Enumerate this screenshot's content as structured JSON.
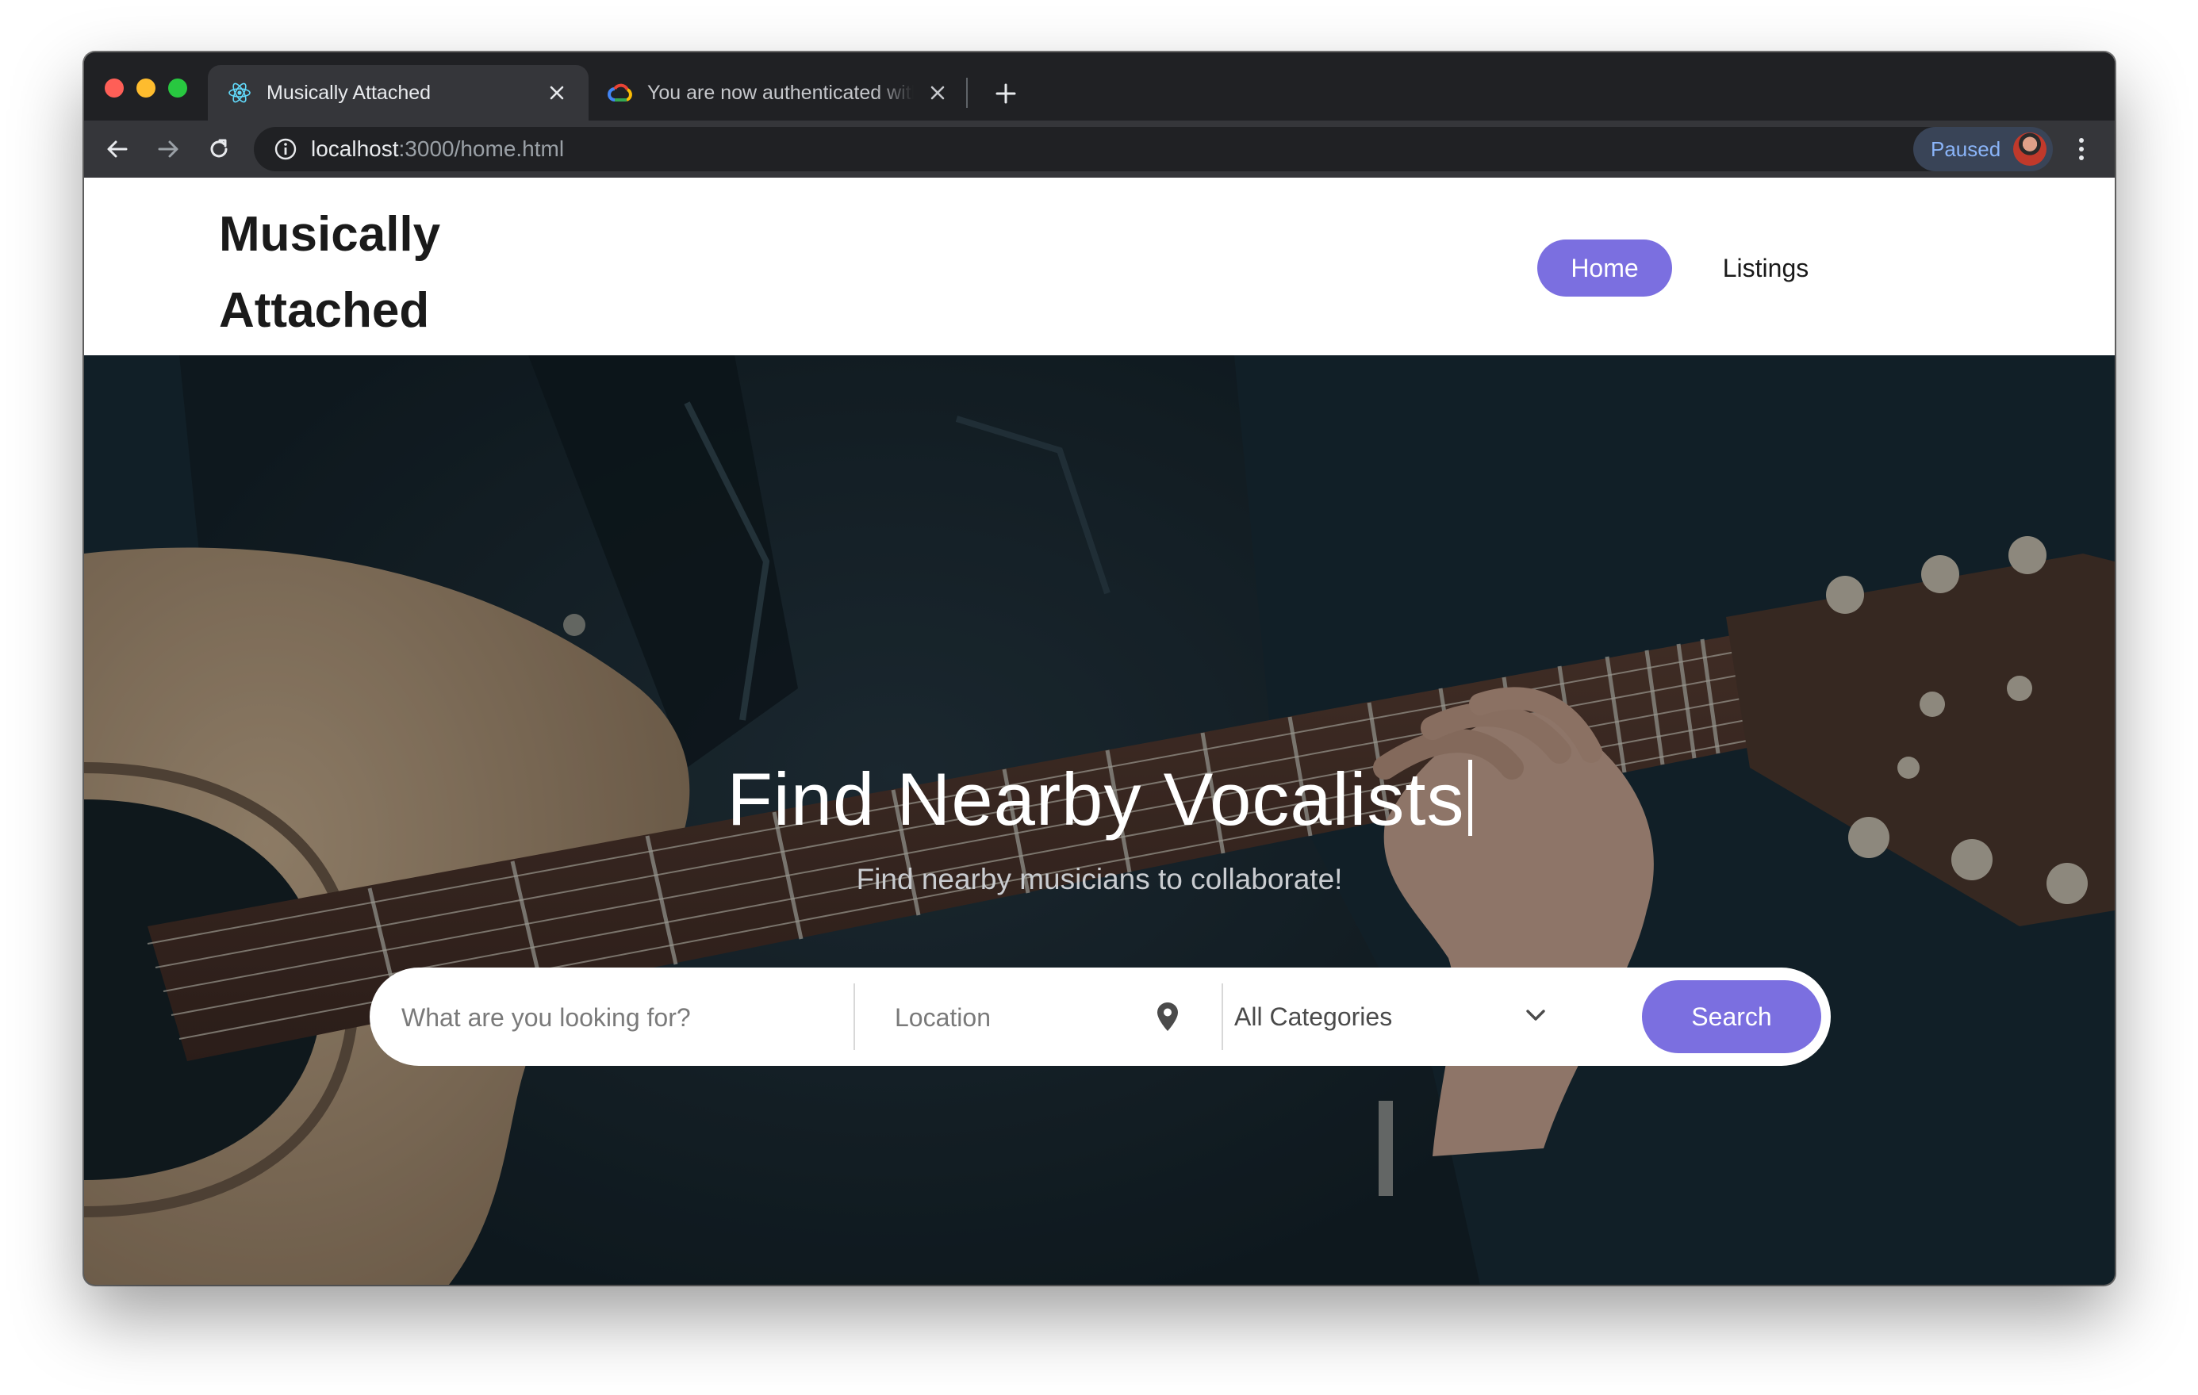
{
  "browser": {
    "tabs": [
      {
        "title": "Musically Attached",
        "active": true,
        "icon": "react-icon"
      },
      {
        "title": "You are now authenticated with",
        "active": false,
        "icon": "google-cloud-icon"
      }
    ],
    "url": {
      "host": "localhost",
      "path": ":3000/home.html"
    },
    "profile_status": "Paused"
  },
  "site": {
    "brand": {
      "line1": "Musically",
      "line2": "Attached"
    },
    "nav": [
      {
        "label": "Home",
        "active": true
      },
      {
        "label": "Listings",
        "active": false
      }
    ]
  },
  "hero": {
    "title": "Find Nearby Vocalists",
    "subtitle": "Find nearby musicians to collaborate!"
  },
  "search": {
    "query_placeholder": "What are you looking for?",
    "location_placeholder": "Location",
    "category_selected": "All Categories",
    "button_label": "Search"
  },
  "colors": {
    "accent": "#7b6fe0",
    "browser_frame": "#202124",
    "toolbar": "#35363a"
  }
}
